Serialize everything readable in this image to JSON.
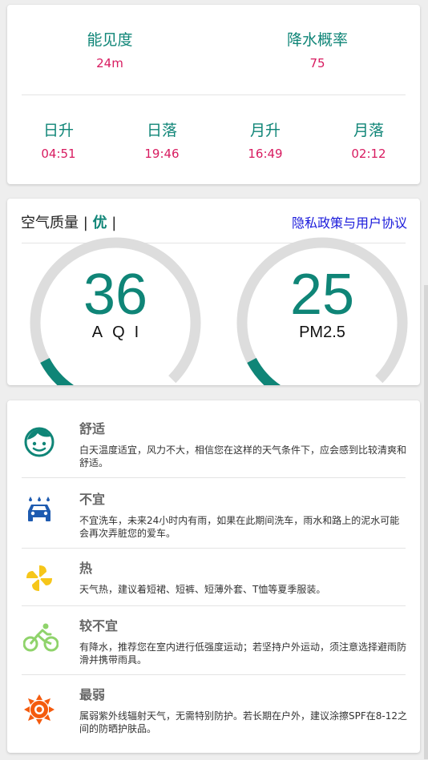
{
  "weather": {
    "visibility": {
      "label": "能见度",
      "value": "24m"
    },
    "precip": {
      "label": "降水概率",
      "value": "75"
    },
    "sunrise": {
      "label": "日升",
      "value": "04:51"
    },
    "sunset": {
      "label": "日落",
      "value": "19:46"
    },
    "moonrise": {
      "label": "月升",
      "value": "16:49"
    },
    "moonset": {
      "label": "月落",
      "value": "02:12"
    }
  },
  "air": {
    "title": "空气质量 | ",
    "quality": "优",
    "title_suffix": " |",
    "privacy_link": "隐私政策与用户协议",
    "aqi": {
      "value": "36",
      "unit": "AQI"
    },
    "pm25": {
      "value": "25",
      "unit": "PM2.5"
    },
    "colors": {
      "accent": "#0f8577",
      "track": "#dddddd"
    }
  },
  "life": [
    {
      "icon": "face-smile-icon",
      "title": "舒适",
      "text": "白天温度适宜，风力不大，相信您在这样的天气条件下，应会感到比较清爽和舒适。"
    },
    {
      "icon": "car-wash-icon",
      "title": "不宜",
      "text": "不宜洗车，未来24小时内有雨，如果在此期间洗车，雨水和路上的泥水可能会再次弄脏您的爱车。"
    },
    {
      "icon": "pinwheel-icon",
      "title": "热",
      "text": "天气热，建议着短裙、短裤、短薄外套、T恤等夏季服装。"
    },
    {
      "icon": "bicycle-icon",
      "title": "较不宜",
      "text": "有降水，推荐您在室内进行低强度运动；若坚持户外运动，须注意选择避雨防滑并携带雨具。"
    },
    {
      "icon": "sun-uv-icon",
      "title": "最弱",
      "text": "属弱紫外线辐射天气，无需特别防护。若长期在户外，建议涂擦SPF在8-12之间的防晒护肤品。"
    }
  ],
  "colors": {
    "teal": "#0f8577",
    "pink": "#d81b60",
    "link": "#1a1adb",
    "car_blue": "#1e5bb0",
    "pinwheel_yellow": "#f6c61a",
    "bike_green": "#8fd36b",
    "sun_orange": "#f45b0e"
  }
}
